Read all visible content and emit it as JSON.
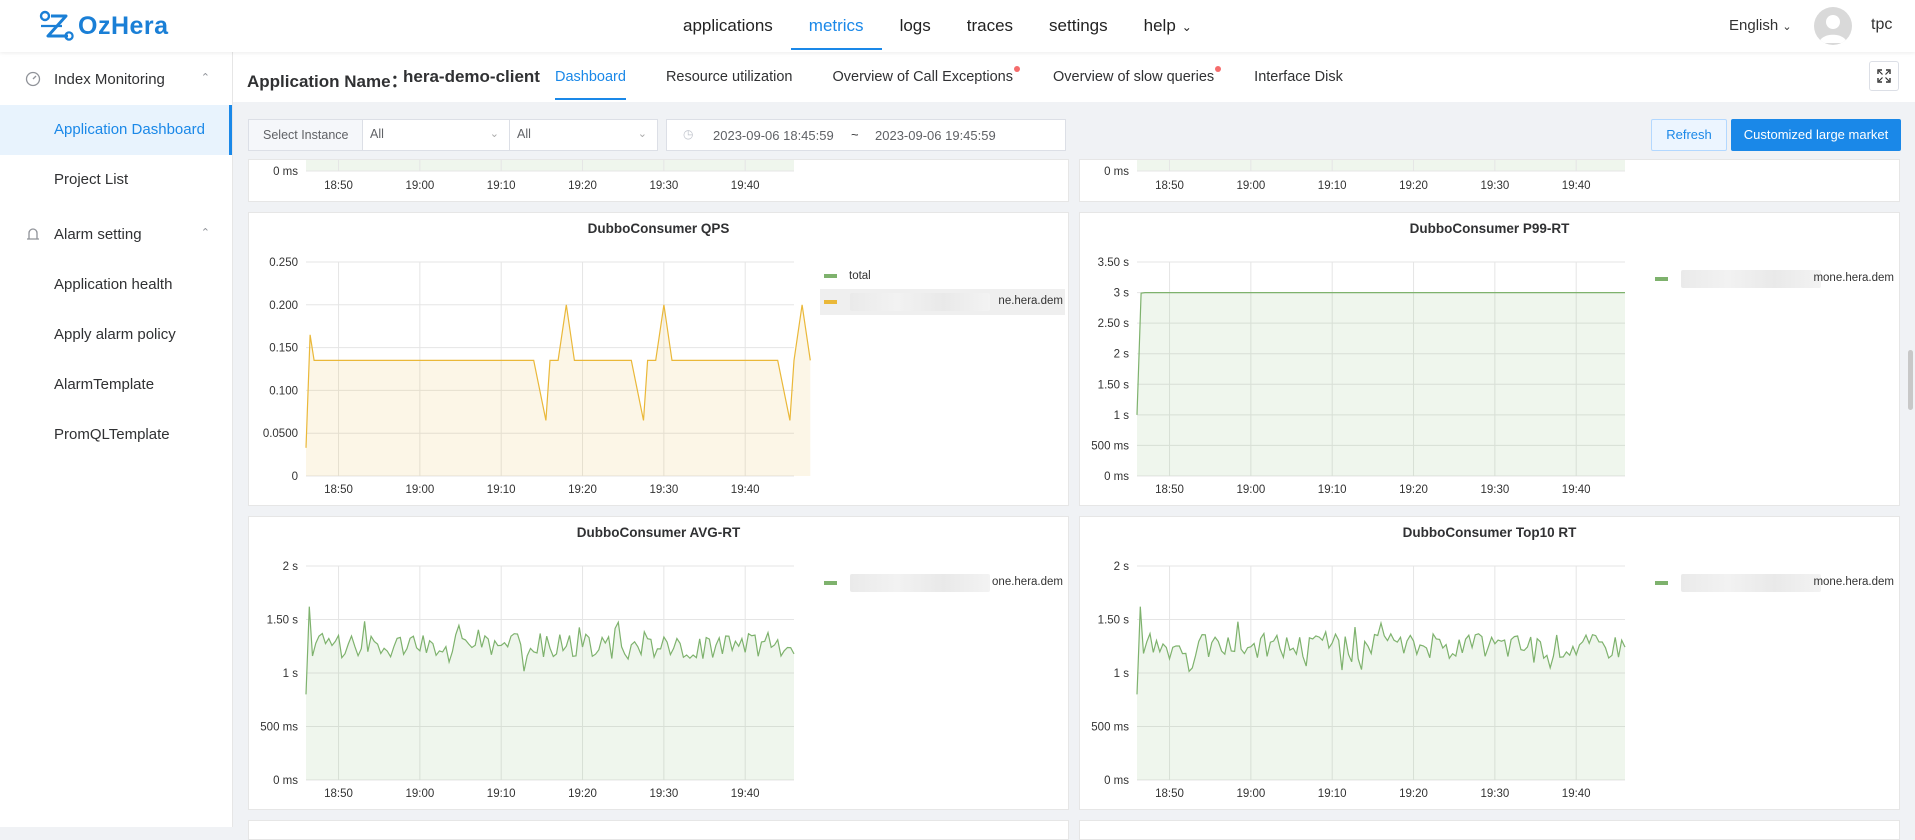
{
  "app": {
    "logo_text": "OzHera",
    "brand_color": "#1a7fd6"
  },
  "topnav": {
    "items": [
      {
        "label": "applications"
      },
      {
        "label": "metrics",
        "active": true
      },
      {
        "label": "logs"
      },
      {
        "label": "traces"
      },
      {
        "label": "settings"
      },
      {
        "label": "help"
      }
    ],
    "language": "English",
    "user": "tpc"
  },
  "sidebar": {
    "groups": [
      {
        "label": "Index Monitoring",
        "icon": "dashboard-gauge-icon",
        "expanded": true,
        "items": [
          {
            "label": "Application Dashboard",
            "active": true
          },
          {
            "label": "Project List"
          }
        ]
      },
      {
        "label": "Alarm setting",
        "icon": "alarm-bell-icon",
        "expanded": true,
        "items": [
          {
            "label": "Application health"
          },
          {
            "label": "Apply alarm policy"
          },
          {
            "label": "AlarmTemplate"
          },
          {
            "label": "PromQLTemplate"
          }
        ]
      }
    ]
  },
  "header": {
    "app_label": "Application Name：",
    "app_name": "hera-demo-client",
    "tabs": [
      {
        "label": "Dashboard",
        "active": true
      },
      {
        "label": "Resource utilization"
      },
      {
        "label": "Overview of Call Exceptions",
        "dot": true
      },
      {
        "label": "Overview of slow queries",
        "dot": true
      },
      {
        "label": "Interface Disk"
      }
    ]
  },
  "filters": {
    "instance_label": "Select Instance",
    "select1": "All",
    "select2": "All",
    "time_start": "2023-09-06 18:45:59",
    "time_sep": "~",
    "time_end": "2023-09-06 19:45:59",
    "refresh_label": "Refresh",
    "market_label": "Customized large market"
  },
  "chart_data": [
    {
      "type": "line",
      "title": "",
      "partial": true,
      "x_ticks": [
        "18:50",
        "19:00",
        "19:10",
        "19:20",
        "19:30",
        "19:40"
      ],
      "y_ticks": [
        "0 ms"
      ],
      "series": []
    },
    {
      "type": "line",
      "title": "",
      "partial": true,
      "x_ticks": [
        "18:50",
        "19:00",
        "19:10",
        "19:20",
        "19:30",
        "19:40"
      ],
      "y_ticks": [
        "0 ms"
      ],
      "series": []
    },
    {
      "type": "area",
      "title": "DubboConsumer QPS",
      "x_ticks": [
        "18:50",
        "19:00",
        "19:10",
        "19:20",
        "19:30",
        "19:40"
      ],
      "y_ticks": [
        "0.250",
        "0.200",
        "0.150",
        "0.100",
        "0.0500",
        "0"
      ],
      "ylim": [
        0,
        0.25
      ],
      "xlim": [
        "18:46",
        "19:46"
      ],
      "color": "#eab839",
      "legend": [
        {
          "name": "total",
          "color": "#7eb26d"
        },
        {
          "name": "ne.hera.dem",
          "color": "#eab839",
          "highlight": true
        }
      ],
      "series": [
        {
          "values_x_min": [
            0,
            0.5,
            1,
            3,
            10,
            20,
            28,
            29.5,
            30,
            31,
            32,
            33,
            34,
            38,
            40,
            41.5,
            42,
            43,
            44,
            45,
            48,
            58,
            59.5,
            60,
            61,
            62
          ],
          "values_y": [
            0.033,
            0.165,
            0.135,
            0.135,
            0.135,
            0.135,
            0.135,
            0.065,
            0.135,
            0.135,
            0.2,
            0.135,
            0.135,
            0.135,
            0.135,
            0.065,
            0.135,
            0.135,
            0.2,
            0.135,
            0.135,
            0.135,
            0.065,
            0.135,
            0.2,
            0.135
          ]
        }
      ]
    },
    {
      "type": "area",
      "title": "DubboConsumer P99-RT",
      "x_ticks": [
        "18:50",
        "19:00",
        "19:10",
        "19:20",
        "19:30",
        "19:40"
      ],
      "y_ticks": [
        "3.50 s",
        "3 s",
        "2.50 s",
        "2 s",
        "1.50 s",
        "1 s",
        "500 ms",
        "0 ms"
      ],
      "ylim": [
        0,
        3.5
      ],
      "color": "#7eb26d",
      "legend": [
        {
          "name": "mone.hera.dem",
          "color": "#7eb26d"
        }
      ],
      "series": [
        {
          "values_x_min": [
            0,
            0.5,
            1,
            60
          ],
          "values_y": [
            1,
            2.99,
            3,
            3
          ]
        }
      ]
    },
    {
      "type": "area",
      "title": "DubboConsumer AVG-RT",
      "x_ticks": [
        "18:50",
        "19:00",
        "19:10",
        "19:20",
        "19:30",
        "19:40"
      ],
      "y_ticks": [
        "2 s",
        "1.50 s",
        "1 s",
        "500 ms",
        "0 ms"
      ],
      "ylim": [
        0,
        2
      ],
      "color": "#7eb26d",
      "legend": [
        {
          "name": "one.hera.dem",
          "color": "#7eb26d"
        }
      ],
      "series": [
        {
          "pattern": "noisy",
          "start": 0.8,
          "peak": 1.62,
          "mean": 1.25,
          "amplitude": 0.12
        }
      ]
    },
    {
      "type": "area",
      "title": "DubboConsumer Top10 RT",
      "x_ticks": [
        "18:50",
        "19:00",
        "19:10",
        "19:20",
        "19:30",
        "19:40"
      ],
      "y_ticks": [
        "2 s",
        "1.50 s",
        "1 s",
        "500 ms",
        "0 ms"
      ],
      "ylim": [
        0,
        2
      ],
      "color": "#7eb26d",
      "legend": [
        {
          "name": "mone.hera.dem",
          "color": "#7eb26d"
        }
      ],
      "series": [
        {
          "pattern": "noisy",
          "start": 0.8,
          "peak": 1.62,
          "mean": 1.25,
          "amplitude": 0.12
        }
      ]
    }
  ]
}
